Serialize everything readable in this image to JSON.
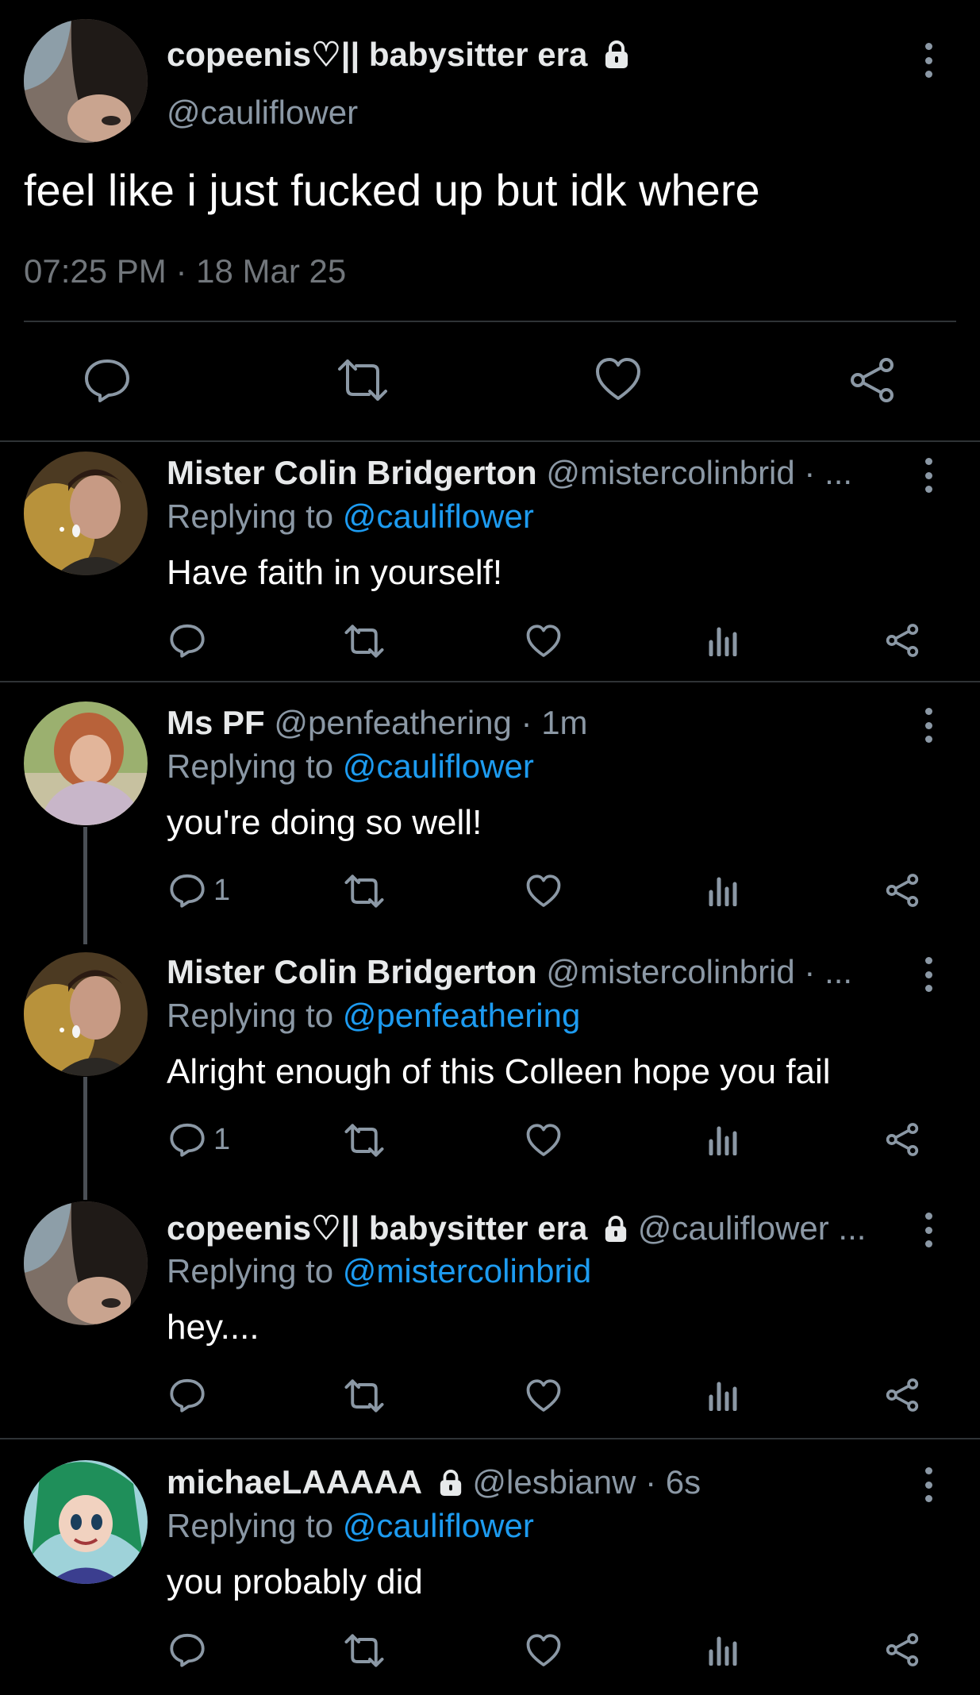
{
  "main_post": {
    "display_name": "copeenis♡|| babysitter era",
    "handle": "@cauliflower",
    "text": "feel like i just fucked up but idk where",
    "timestamp": "07:25 PM · 18 Mar 25"
  },
  "replies": [
    {
      "display_name": "Mister Colin Bridgerton",
      "handle_meta": "@mistercolinbrid · ...",
      "replying_prefix": "Replying to ",
      "replying_to": "@cauliflower",
      "text": "Have faith in yourself!",
      "reply_count": ""
    },
    {
      "display_name": "Ms PF",
      "handle_meta": "@penfeathering · 1m",
      "replying_prefix": "Replying to ",
      "replying_to": "@cauliflower",
      "text": "you're doing so well!",
      "reply_count": "1"
    },
    {
      "display_name": "Mister Colin Bridgerton",
      "handle_meta": "@mistercolinbrid · ...",
      "replying_prefix": "Replying to ",
      "replying_to": "@penfeathering",
      "text": "Alright enough of this Colleen hope you fail",
      "reply_count": "1"
    },
    {
      "display_name": "copeenis♡|| babysitter era",
      "handle_meta": "@cauliflower ...",
      "replying_prefix": "Replying to ",
      "replying_to": "@mistercolinbrid",
      "text": "hey....",
      "reply_count": ""
    },
    {
      "display_name": "michaeLAAAAA",
      "handle_meta": "@lesbianw · 6s",
      "replying_prefix": "Replying to ",
      "replying_to": "@cauliflower",
      "text": "you probably did",
      "reply_count": ""
    }
  ],
  "icons": {
    "reply": "speech-bubble-icon",
    "retweet": "retweet-icon",
    "like": "heart-icon",
    "views": "bar-chart-icon",
    "share": "share-icon",
    "locked": "lock-icon",
    "more": "more-vertical-icon"
  },
  "colors": {
    "background": "#000000",
    "text": "#e7e9ea",
    "muted": "#8b98a5",
    "link": "#1d9bf0",
    "divider": "#2f3336"
  }
}
